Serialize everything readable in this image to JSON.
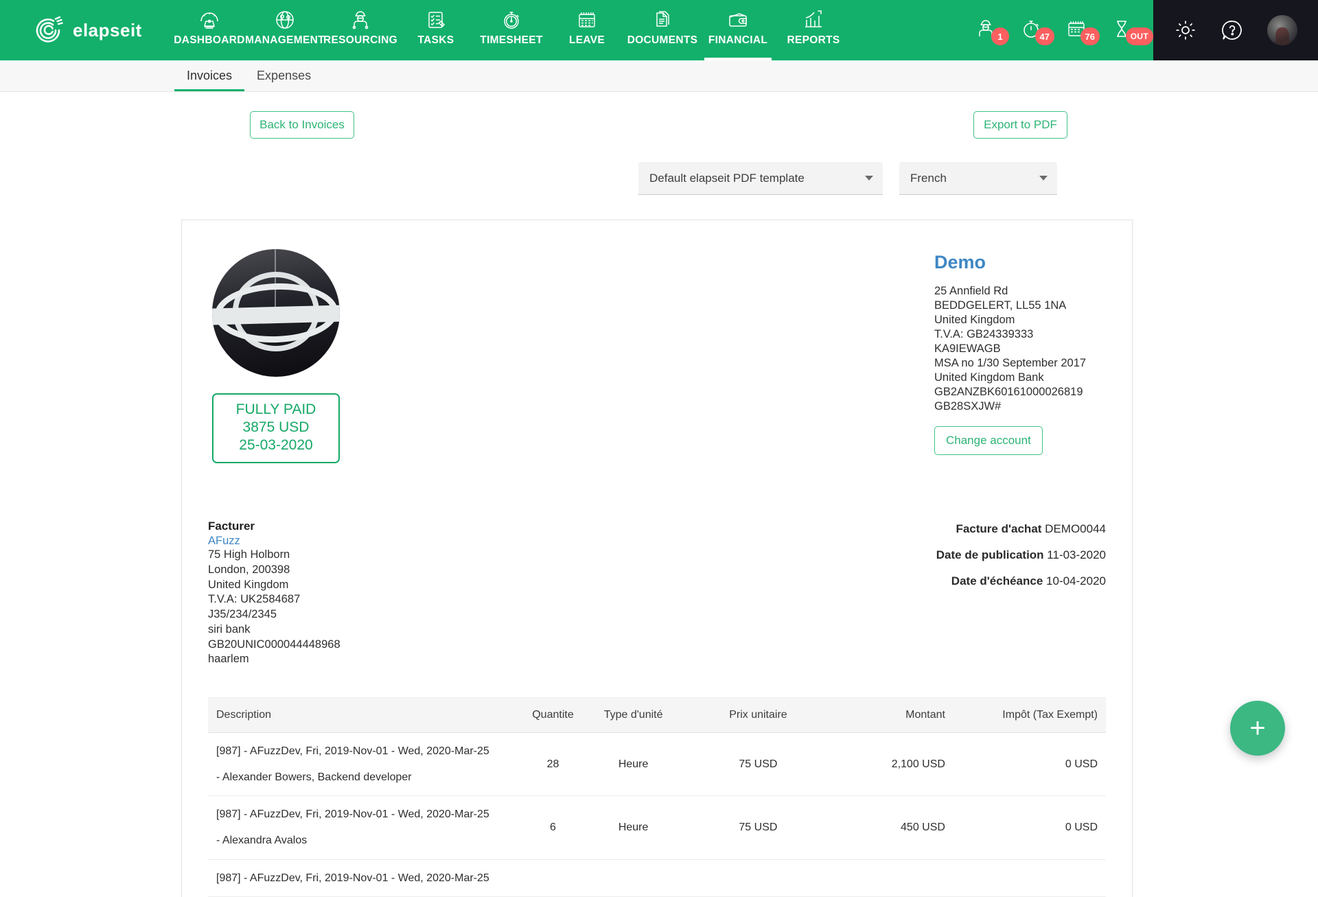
{
  "brand": {
    "name": "elapseit",
    "logo_icon": "elapseit-swirl-icon"
  },
  "nav": {
    "items": [
      {
        "label": "DASHBOARD",
        "icon": "gauge-icon",
        "active": false
      },
      {
        "label": "MANAGEMENT",
        "icon": "globe-icon",
        "active": false
      },
      {
        "label": "RESOURCING",
        "icon": "worker-icon",
        "active": false
      },
      {
        "label": "TASKS",
        "icon": "checklist-icon",
        "active": false
      },
      {
        "label": "TIMESHEET",
        "icon": "stopwatch-icon",
        "active": false
      },
      {
        "label": "LEAVE",
        "icon": "calendar-icon",
        "active": false
      },
      {
        "label": "DOCUMENTS",
        "icon": "documents-icon",
        "active": false
      },
      {
        "label": "FINANCIAL",
        "icon": "wallet-icon",
        "active": true
      },
      {
        "label": "REPORTS",
        "icon": "bar-chart-icon",
        "active": false
      }
    ],
    "status": [
      {
        "icon": "worker-icon",
        "badge": "1"
      },
      {
        "icon": "stopwatch-icon",
        "badge": "47"
      },
      {
        "icon": "calendar-icon",
        "badge": "76"
      },
      {
        "icon": "hourglass-icon",
        "badge": "OUT"
      }
    ],
    "right": [
      {
        "icon": "gear-icon"
      },
      {
        "icon": "help-chat-icon"
      },
      {
        "icon": "avatar"
      }
    ],
    "badge_color": "#fb5f5f",
    "bar_color": "#13b06b",
    "right_bg": "#16161f"
  },
  "subtabs": [
    {
      "label": "Invoices",
      "active": true
    },
    {
      "label": "Expenses",
      "active": false
    }
  ],
  "actions": {
    "back_label": "Back to Invoices",
    "export_label": "Export to PDF"
  },
  "selectors": {
    "template": {
      "value": "Default elapseit PDF template",
      "caret_icon": "chevron-down-icon"
    },
    "language": {
      "value": "French",
      "caret_icon": "chevron-down-icon"
    }
  },
  "invoice": {
    "logo_icon": "company-logo-image",
    "status_badge": {
      "status": "FULLY PAID",
      "amount": "3875 USD",
      "date": "25-03-2020",
      "color": "#16a866"
    },
    "company": {
      "name": "Demo",
      "name_color": "#3f87c4",
      "address_lines": [
        "25 Annfield Rd",
        "BEDDGELERT, LL55 1NA",
        "United Kingdom",
        "T.V.A: GB24339333",
        "KA9IEWAGB",
        "MSA no 1/30 September 2017",
        "United Kingdom Bank",
        "GB2ANZBK60161000026819",
        "GB28SXJW#"
      ],
      "change_account_label": "Change account"
    },
    "bill_to": {
      "title": "Facturer",
      "client_link": "AFuzz",
      "lines": [
        "75 High Holborn",
        "London, 200398",
        "United Kingdom",
        "T.V.A: UK2584687",
        "J35/234/2345",
        "siri bank",
        "GB20UNIC000044448968",
        "haarlem"
      ]
    },
    "meta": [
      {
        "label": "Facture d'achat",
        "value": "DEMO0044"
      },
      {
        "label": "Date de publication",
        "value": "11-03-2020"
      },
      {
        "label": "Date d'échéance",
        "value": "10-04-2020"
      }
    ],
    "table": {
      "headers": [
        "Description",
        "Quantite",
        "Type d'unité",
        "Prix unitaire",
        "Montant",
        "Impôt (Tax Exempt)"
      ],
      "rows": [
        {
          "desc_line1": "[987] - AFuzzDev, Fri, 2019-Nov-01 - Wed, 2020-Mar-25",
          "desc_line2": "- Alexander Bowers, Backend developer",
          "quantity": "28",
          "unit_type": "Heure",
          "unit_price": "75 USD",
          "amount": "2,100 USD",
          "tax": "0 USD"
        },
        {
          "desc_line1": "[987] - AFuzzDev, Fri, 2019-Nov-01 - Wed, 2020-Mar-25",
          "desc_line2": "- Alexandra Avalos",
          "quantity": "6",
          "unit_type": "Heure",
          "unit_price": "75 USD",
          "amount": "450 USD",
          "tax": "0 USD"
        },
        {
          "desc_line1": "[987] - AFuzzDev, Fri, 2019-Nov-01 - Wed, 2020-Mar-25",
          "desc_line2": "",
          "quantity": "",
          "unit_type": "",
          "unit_price": "",
          "amount": "",
          "tax": ""
        }
      ]
    }
  },
  "fab": {
    "label": "+",
    "icon": "plus-icon",
    "color": "#3cb883"
  }
}
